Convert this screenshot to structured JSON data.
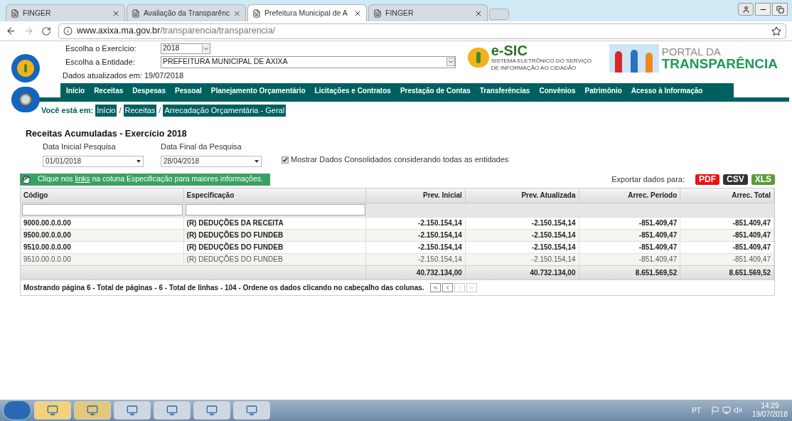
{
  "browser": {
    "tabs": [
      {
        "title": "FINGER",
        "selected": false
      },
      {
        "title": "Avaliação da Transparênc",
        "selected": false
      },
      {
        "title": "Prefeitura Municipal de A",
        "selected": true
      },
      {
        "title": "FINGER",
        "selected": false
      }
    ],
    "url_host": "www.axixa.ma.gov.br",
    "url_path": "/transparencia/transparencia/"
  },
  "header": {
    "exercise_label": "Escolha o Exercício:",
    "exercise_value": "2018",
    "entity_label": "Escolha a Entidade:",
    "entity_value": "PREFEITURA MUNICIPAL DE AXIXA",
    "updated": "Dados atualizados em: 19/07/2018",
    "esic_title": "e-SIC",
    "esic_subtitle": "SISTEMA ELETRÔNICO DO SERVIÇO DE INFORMAÇÃO AO CIDADÃO",
    "portal_line1": "PORTAL DA",
    "portal_line2": "TRANSPARÊNCIA"
  },
  "nav": [
    "Início",
    "Receitas",
    "Despesas",
    "Pessoal",
    "Planejamento Orçamentário",
    "Licitações e Contratos",
    "Prestação de Contas",
    "Transferências",
    "Convênios",
    "Patrimônio",
    "Acesso à Informação"
  ],
  "breadcrumb": {
    "label": "Você está em:",
    "separator": "/",
    "items": [
      "Início",
      "Receitas",
      "Arrecadação Orçamentária - Geral"
    ]
  },
  "title": "Receitas Acumuladas - Exercício 2018",
  "filters": {
    "start_label": "Data Inicial Pesquisa",
    "start_value": "01/01/2018",
    "end_label": "Data Final da Pesquisa",
    "end_value": "28/04/2018",
    "consolidated_label": "Mostrar Dados Consolidados considerando todas as entidades",
    "consolidated_checked": true
  },
  "hint": {
    "before": "Clique nos ",
    "link": "links",
    "after": " na coluna Especificação para maiores informações."
  },
  "export": {
    "label": "Exportar dados para:",
    "formats": [
      {
        "label": "PDF",
        "color": "#ee1111"
      },
      {
        "label": "CSV",
        "color": "#333333"
      },
      {
        "label": "XLS",
        "color": "#5a9a3a"
      }
    ]
  },
  "table": {
    "columns": [
      "Código",
      "Especificação",
      "Prev. Inicial",
      "Prev. Atualizada",
      "Arrec. Período",
      "Arrec. Total"
    ],
    "rows": [
      {
        "bold": true,
        "cells": [
          "9000.00.0.0.00",
          "(R) DEDUÇÕES DA RECEITA",
          "-2.150.154,14",
          "-2.150.154,14",
          "-851.409,47",
          "-851.409,47"
        ]
      },
      {
        "bold": true,
        "cells": [
          "9500.00.0.0.00",
          "(R) DEDUÇÕES DO FUNDEB",
          "-2.150.154,14",
          "-2.150.154,14",
          "-851.409,47",
          "-851.409,47"
        ]
      },
      {
        "bold": true,
        "cells": [
          "9510.00.0.0.00",
          "(R) DEDUÇÕES DO FUNDEB",
          "-2.150.154,14",
          "-2.150.154,14",
          "-851.409,47",
          "-851.409,47"
        ]
      },
      {
        "bold": false,
        "cells": [
          "9510.00.0.0.00",
          "(R) DEDUÇÕES DO FUNDEB",
          "-2.150.154,14",
          "-2.150.154,14",
          "-851.409,47",
          "-851.409,47"
        ]
      }
    ],
    "totals": [
      "40.732.134,00",
      "40.732.134,00",
      "8.651.569,52",
      "8.651.569,52"
    ],
    "footer": "Mostrando página 6 - Total de páginas - 6 - Total de linhas - 104 - Ordene os dados clicando no cabeçalho das colunas.",
    "pager": [
      {
        "kind": "first",
        "disabled": false
      },
      {
        "kind": "prev",
        "disabled": false
      },
      {
        "kind": "next",
        "disabled": true
      },
      {
        "kind": "last",
        "disabled": true
      }
    ]
  },
  "taskbar": {
    "language": "PT",
    "time": "14:29",
    "date": "19/07/2018"
  }
}
